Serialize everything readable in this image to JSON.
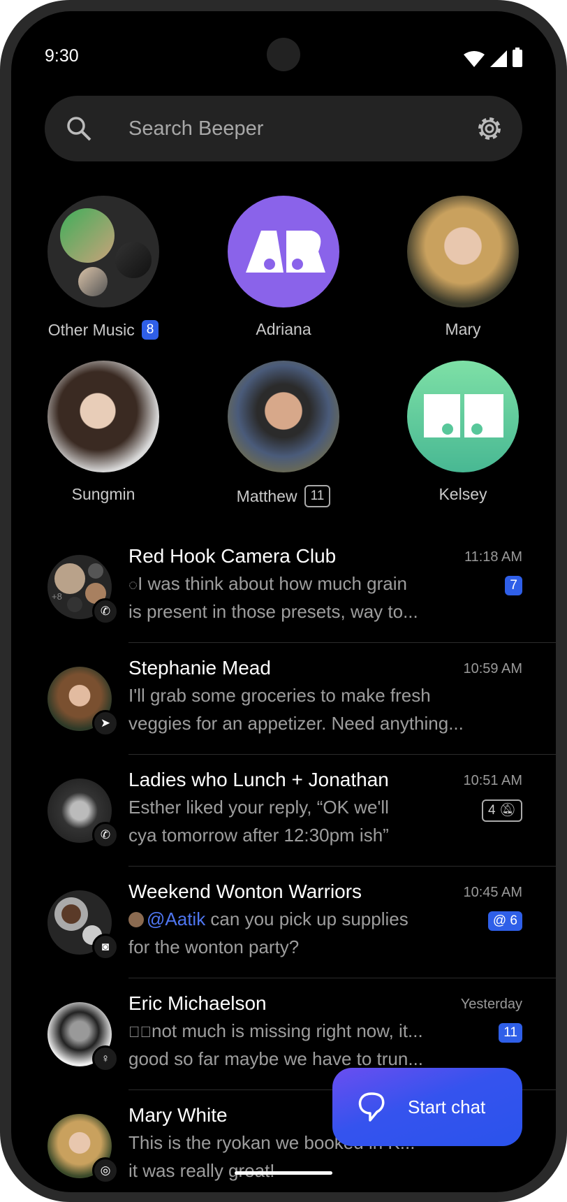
{
  "status": {
    "time": "9:30"
  },
  "search": {
    "placeholder": "Search Beeper"
  },
  "favorites": [
    {
      "name": "Other Music",
      "badge": "8",
      "badge_style": "filled"
    },
    {
      "name": "Adriana",
      "initials": "AR",
      "color": "#8a63ea"
    },
    {
      "name": "Mary"
    },
    {
      "name": "Sungmin"
    },
    {
      "name": "Matthew",
      "badge": "11",
      "badge_style": "outline"
    },
    {
      "name": "Kelsey",
      "initials": "KW",
      "color": "#5fcf9a"
    }
  ],
  "chats": [
    {
      "title": "Red Hook Camera Club",
      "time": "11:18 AM",
      "line1": "I was think about how much grain",
      "line2": "is present in those presets, way to...",
      "badge": "7",
      "network": "whatsapp",
      "extra": "+8"
    },
    {
      "title": "Stephanie Mead",
      "time": "10:59 AM",
      "line1": "I'll grab some groceries to make fresh",
      "line2": "veggies for an appetizer. Need anything...",
      "network": "telegram"
    },
    {
      "title": "Ladies who Lunch + Jonathan",
      "time": "10:51 AM",
      "line1": "Esther liked your reply, “OK we'll",
      "line2": "cya tomorrow after 12:30pm ish”",
      "badge": "4",
      "muted": true,
      "network": "whatsapp"
    },
    {
      "title": "Weekend Wonton Warriors",
      "time": "10:45 AM",
      "mention": "@Aatik",
      "line1": " can you pick up supplies",
      "line2": "for the wonton party?",
      "badge": "@ 6",
      "network": "discord"
    },
    {
      "title": "Eric Michaelson",
      "time": "Yesterday",
      "line1": "not much is missing right now, it...",
      "line2": "good so far maybe we have to trun...",
      "badge": "11",
      "network": "beeper"
    },
    {
      "title": "Mary White",
      "time": "",
      "line1": "This is the ryokan we booked in K...",
      "line2": "it was really great!",
      "network": "instagram"
    }
  ],
  "fab": {
    "label": "Start chat"
  },
  "colors": {
    "accent": "#2f5fe8",
    "background": "#000000"
  }
}
